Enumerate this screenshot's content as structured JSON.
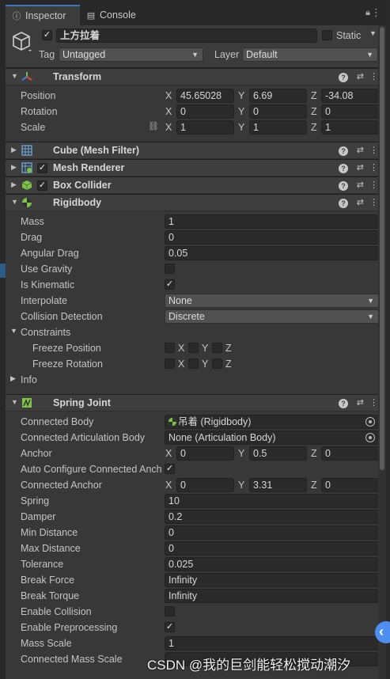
{
  "tabs": [
    {
      "label": "Inspector",
      "icon": "info-icon"
    },
    {
      "label": "Console",
      "icon": "console-icon"
    }
  ],
  "header": {
    "name": "上方拉着",
    "static_label": "Static",
    "tag_label": "Tag",
    "tag_value": "Untagged",
    "layer_label": "Layer",
    "layer_value": "Default"
  },
  "transform": {
    "title": "Transform",
    "position_label": "Position",
    "rotation_label": "Rotation",
    "scale_label": "Scale",
    "position": {
      "x": "45.65028",
      "y": "6.69",
      "z": "-34.08"
    },
    "rotation": {
      "x": "0",
      "y": "0",
      "z": "0"
    },
    "scale": {
      "x": "1",
      "y": "1",
      "z": "1"
    }
  },
  "axes": {
    "x": "X",
    "y": "Y",
    "z": "Z"
  },
  "components": {
    "mesh_filter": "Cube (Mesh Filter)",
    "mesh_renderer": "Mesh Renderer",
    "box_collider": "Box Collider"
  },
  "rigidbody": {
    "title": "Rigidbody",
    "mass_label": "Mass",
    "mass": "1",
    "drag_label": "Drag",
    "drag": "0",
    "angular_drag_label": "Angular Drag",
    "angular_drag": "0.05",
    "use_gravity_label": "Use Gravity",
    "is_kinematic_label": "Is Kinematic",
    "interpolate_label": "Interpolate",
    "interpolate": "None",
    "collision_label": "Collision Detection",
    "collision": "Discrete",
    "constraints_label": "Constraints",
    "freeze_position_label": "Freeze Position",
    "freeze_rotation_label": "Freeze Rotation",
    "info_label": "Info"
  },
  "spring": {
    "title": "Spring Joint",
    "connected_body_label": "Connected Body",
    "connected_body": "吊着 (Rigidbody)",
    "connected_art_label": "Connected Articulation Body",
    "connected_art": "None (Articulation Body)",
    "anchor_label": "Anchor",
    "anchor": {
      "x": "0",
      "y": "0.5",
      "z": "0"
    },
    "auto_label": "Auto Configure Connected Anch",
    "connected_anchor_label": "Connected Anchor",
    "connected_anchor": {
      "x": "0",
      "y": "3.31",
      "z": "0"
    },
    "spring_label": "Spring",
    "spring": "10",
    "damper_label": "Damper",
    "damper": "0.2",
    "min_label": "Min Distance",
    "min": "0",
    "max_label": "Max Distance",
    "max": "0",
    "tolerance_label": "Tolerance",
    "tolerance": "0.025",
    "break_force_label": "Break Force",
    "break_force": "Infinity",
    "break_torque_label": "Break Torque",
    "break_torque": "Infinity",
    "enable_collision_label": "Enable Collision",
    "enable_pre_label": "Enable Preprocessing",
    "mass_scale_label": "Mass Scale",
    "mass_scale": "1",
    "connected_mass_scale_label": "Connected Mass Scale"
  },
  "watermark": "CSDN @我的巨剑能轻松搅动潮汐",
  "colors": {
    "accent": "#3a79bb",
    "panel": "#383838",
    "field": "#2a2a2a"
  }
}
